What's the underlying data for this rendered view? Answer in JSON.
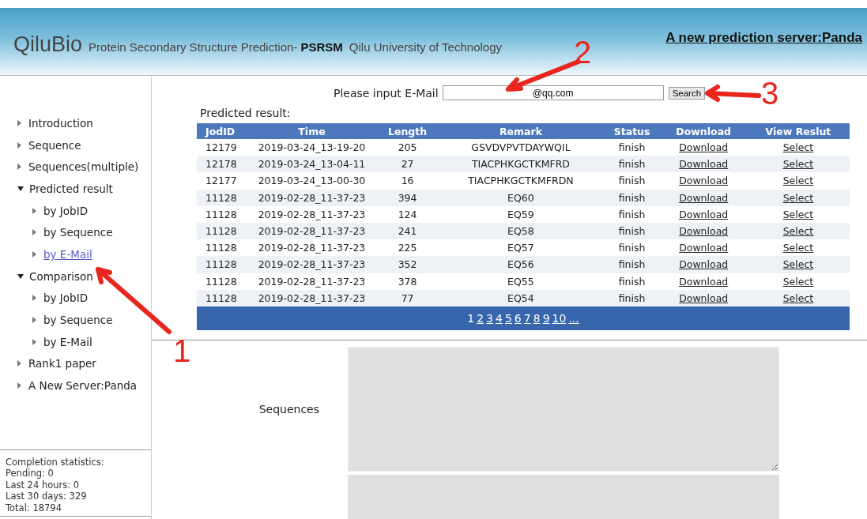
{
  "header": {
    "logo": "QiluBio",
    "subtitle_prefix": "Protein Secondary Structure Prediction-",
    "subtitle_bold": "PSRSM",
    "institution": "Qilu University of Technology",
    "link": "A new prediction server:Panda"
  },
  "sidebar": {
    "items": [
      {
        "label": "Introduction",
        "expanded": false,
        "selected": false
      },
      {
        "label": "Sequence",
        "expanded": false,
        "selected": false
      },
      {
        "label": "Sequences(multiple)",
        "expanded": false,
        "selected": false
      },
      {
        "label": "Predicted result",
        "expanded": true,
        "selected": false,
        "children": [
          {
            "label": "by JobID",
            "expanded": false,
            "selected": false
          },
          {
            "label": "by Sequence",
            "expanded": false,
            "selected": false
          },
          {
            "label": "by E-Mail",
            "expanded": false,
            "selected": true
          }
        ]
      },
      {
        "label": "Comparison",
        "expanded": true,
        "selected": false,
        "children": [
          {
            "label": "by JobID",
            "expanded": false,
            "selected": false
          },
          {
            "label": "by Sequence",
            "expanded": false,
            "selected": false
          },
          {
            "label": "by E-Mail",
            "expanded": false,
            "selected": false
          }
        ]
      },
      {
        "label": "Rank1 paper",
        "expanded": false,
        "selected": false
      },
      {
        "label": "A New Server:Panda",
        "expanded": false,
        "selected": false
      }
    ],
    "stats": [
      "Completion statistics:",
      "Pending:  0",
      "Last 24 hours:  0",
      "Last 30 days:  329",
      "Total:  18794"
    ]
  },
  "search": {
    "label": "Please input E-Mail",
    "value": "@qq.com",
    "button": "Search"
  },
  "result_title": "Predicted result:",
  "table": {
    "columns": [
      "JodID",
      "Time",
      "Length",
      "Remark",
      "Status",
      "Download",
      "View Reslut"
    ],
    "rows": [
      [
        "12179",
        "2019-03-24_13-19-20",
        "205",
        "GSVDVPVTDAYWQIL",
        "finish",
        "Download",
        "Select"
      ],
      [
        "12178",
        "2019-03-24_13-04-11",
        "27",
        "TIACPHKGCTKMFRD",
        "finish",
        "Download",
        "Select"
      ],
      [
        "12177",
        "2019-03-24_13-00-30",
        "16",
        "TIACPHKGCTKMFRDN",
        "finish",
        "Download",
        "Select"
      ],
      [
        "11128",
        "2019-02-28_11-37-23",
        "394",
        "EQ60",
        "finish",
        "Download",
        "Select"
      ],
      [
        "11128",
        "2019-02-28_11-37-23",
        "124",
        "EQ59",
        "finish",
        "Download",
        "Select"
      ],
      [
        "11128",
        "2019-02-28_11-37-23",
        "241",
        "EQ58",
        "finish",
        "Download",
        "Select"
      ],
      [
        "11128",
        "2019-02-28_11-37-23",
        "225",
        "EQ57",
        "finish",
        "Download",
        "Select"
      ],
      [
        "11128",
        "2019-02-28_11-37-23",
        "352",
        "EQ56",
        "finish",
        "Download",
        "Select"
      ],
      [
        "11128",
        "2019-02-28_11-37-23",
        "378",
        "EQ55",
        "finish",
        "Download",
        "Select"
      ],
      [
        "11128",
        "2019-02-28_11-37-23",
        "77",
        "EQ54",
        "finish",
        "Download",
        "Select"
      ]
    ]
  },
  "pagination": [
    {
      "label": "1",
      "selected": true
    },
    {
      "label": "2",
      "selected": false
    },
    {
      "label": "3",
      "selected": false
    },
    {
      "label": "4",
      "selected": false
    },
    {
      "label": "5",
      "selected": false
    },
    {
      "label": "6",
      "selected": false
    },
    {
      "label": "7",
      "selected": false
    },
    {
      "label": "8",
      "selected": false
    },
    {
      "label": "9",
      "selected": false
    },
    {
      "label": "10",
      "selected": false
    },
    {
      "label": "...",
      "selected": false
    }
  ],
  "form": {
    "sequences_label": "Sequences"
  },
  "annotations": [
    "1",
    "2",
    "3"
  ]
}
